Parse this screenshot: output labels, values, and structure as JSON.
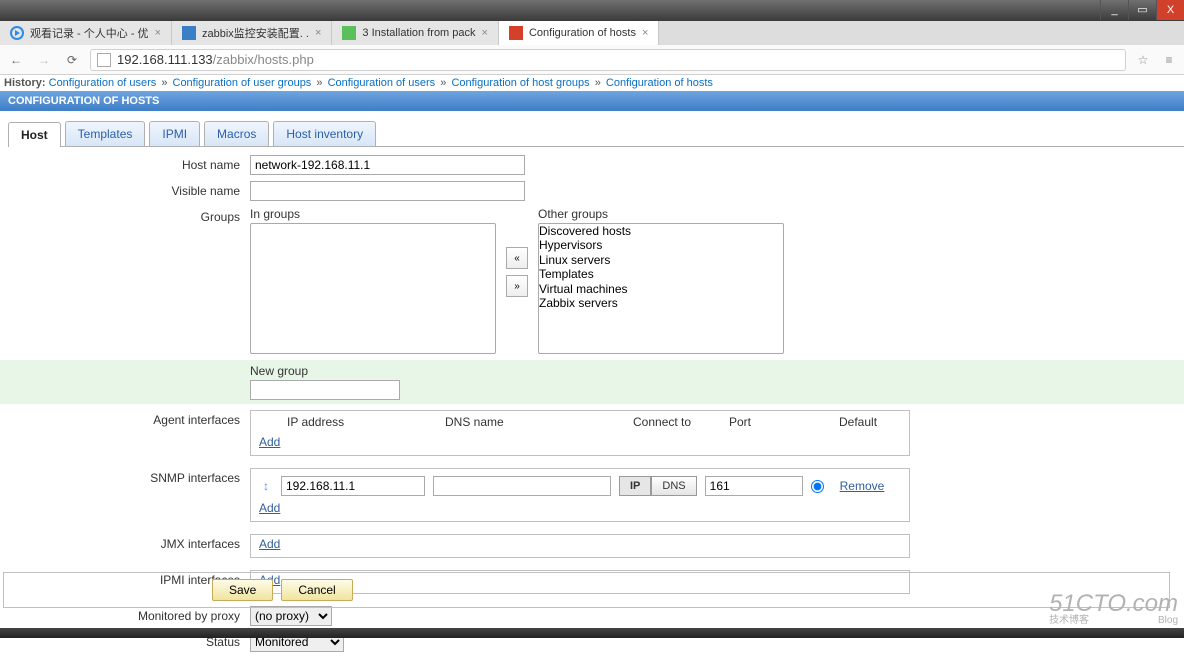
{
  "window": {
    "min": "_",
    "max": "▭",
    "close": "X"
  },
  "browser_tabs": [
    {
      "label": "观看记录 - 个人中心 - 优",
      "fav": "fv-play"
    },
    {
      "label": "zabbix监控安装配置.  .",
      "fav": "fv-cn"
    },
    {
      "label": "3 Installation from pack",
      "fav": "fv-book"
    },
    {
      "label": "Configuration of hosts",
      "fav": "fv-zbx"
    }
  ],
  "addr": {
    "host": "192.168.111.133",
    "path": "/zabbix/hosts.php"
  },
  "breadcrumb": {
    "prefix": "History:",
    "items": [
      "Configuration of users",
      "Configuration of user groups",
      "Configuration of users",
      "Configuration of host groups",
      "Configuration of hosts"
    ],
    "sep": "»"
  },
  "conf_title": "CONFIGURATION OF HOSTS",
  "ztabs": [
    "Host",
    "Templates",
    "IPMI",
    "Macros",
    "Host inventory"
  ],
  "labels": {
    "hostname": "Host name",
    "visiblename": "Visible name",
    "groups": "Groups",
    "ingroups": "In groups",
    "othergroups": "Other groups",
    "newgroup": "New group",
    "agentif": "Agent interfaces",
    "snmpif": "SNMP interfaces",
    "jmxif": "JMX interfaces",
    "ipmiif": "IPMI interfaces",
    "monproxy": "Monitored by proxy",
    "status": "Status"
  },
  "iface_headers": {
    "ip": "IP address",
    "dns": "DNS name",
    "connect": "Connect to",
    "port": "Port",
    "default": "Default"
  },
  "fields": {
    "hostname": "network-192.168.11.1",
    "visiblename": "",
    "newgroup": ""
  },
  "other_groups": [
    "Discovered hosts",
    "Hypervisors",
    "Linux servers",
    "Templates",
    "Virtual machines",
    "Zabbix servers"
  ],
  "mover": {
    "left": "«",
    "right": "»"
  },
  "snmp": {
    "ip": "192.168.11.1",
    "dns": "",
    "port": "161",
    "conn_ip": "IP",
    "conn_dns": "DNS"
  },
  "links": {
    "add": "Add",
    "remove": "Remove"
  },
  "proxy": "(no proxy)",
  "status": "Monitored",
  "buttons": {
    "save": "Save",
    "cancel": "Cancel"
  },
  "watermark": {
    "big": "51CTO.com",
    "sm1": "技术博客",
    "sm2": "Blog"
  }
}
